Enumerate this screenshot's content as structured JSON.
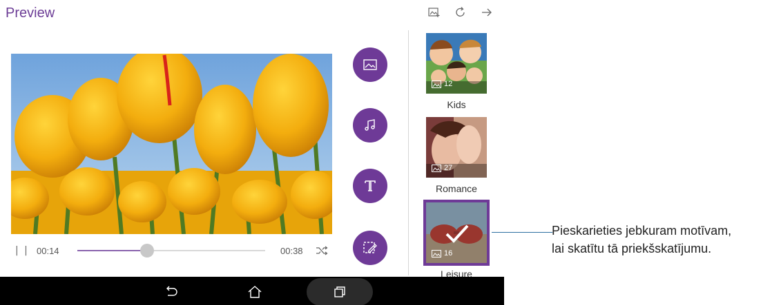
{
  "header": {
    "title": "Preview",
    "icons": [
      "add-photo-icon",
      "refresh-icon",
      "arrow-forward-icon"
    ]
  },
  "player": {
    "current_time": "00:14",
    "total_time": "00:38",
    "progress": 0.37,
    "icons": [
      "pause-icon",
      "shuffle-icon"
    ]
  },
  "actions": [
    {
      "name": "photos-button",
      "icon": "image-icon"
    },
    {
      "name": "music-button",
      "icon": "music-note-icon"
    },
    {
      "name": "text-button",
      "icon": "text-icon"
    },
    {
      "name": "effects-button",
      "icon": "edit-film-icon"
    }
  ],
  "themes": [
    {
      "label": "Kids",
      "count": "12",
      "selected": false
    },
    {
      "label": "Romance",
      "count": "27",
      "selected": false
    },
    {
      "label": "Leisure",
      "count": "16",
      "selected": true
    }
  ],
  "navbar": {
    "icons": [
      "back-icon",
      "home-icon",
      "recent-apps-icon"
    ]
  },
  "callout": {
    "line1": "Pieskarieties jebkuram motīvam,",
    "line2": "lai skatītu tā priekšskatījumu."
  },
  "colors": {
    "accent": "#6e3a97",
    "title": "#6c3d96",
    "navbar": "#000000"
  }
}
